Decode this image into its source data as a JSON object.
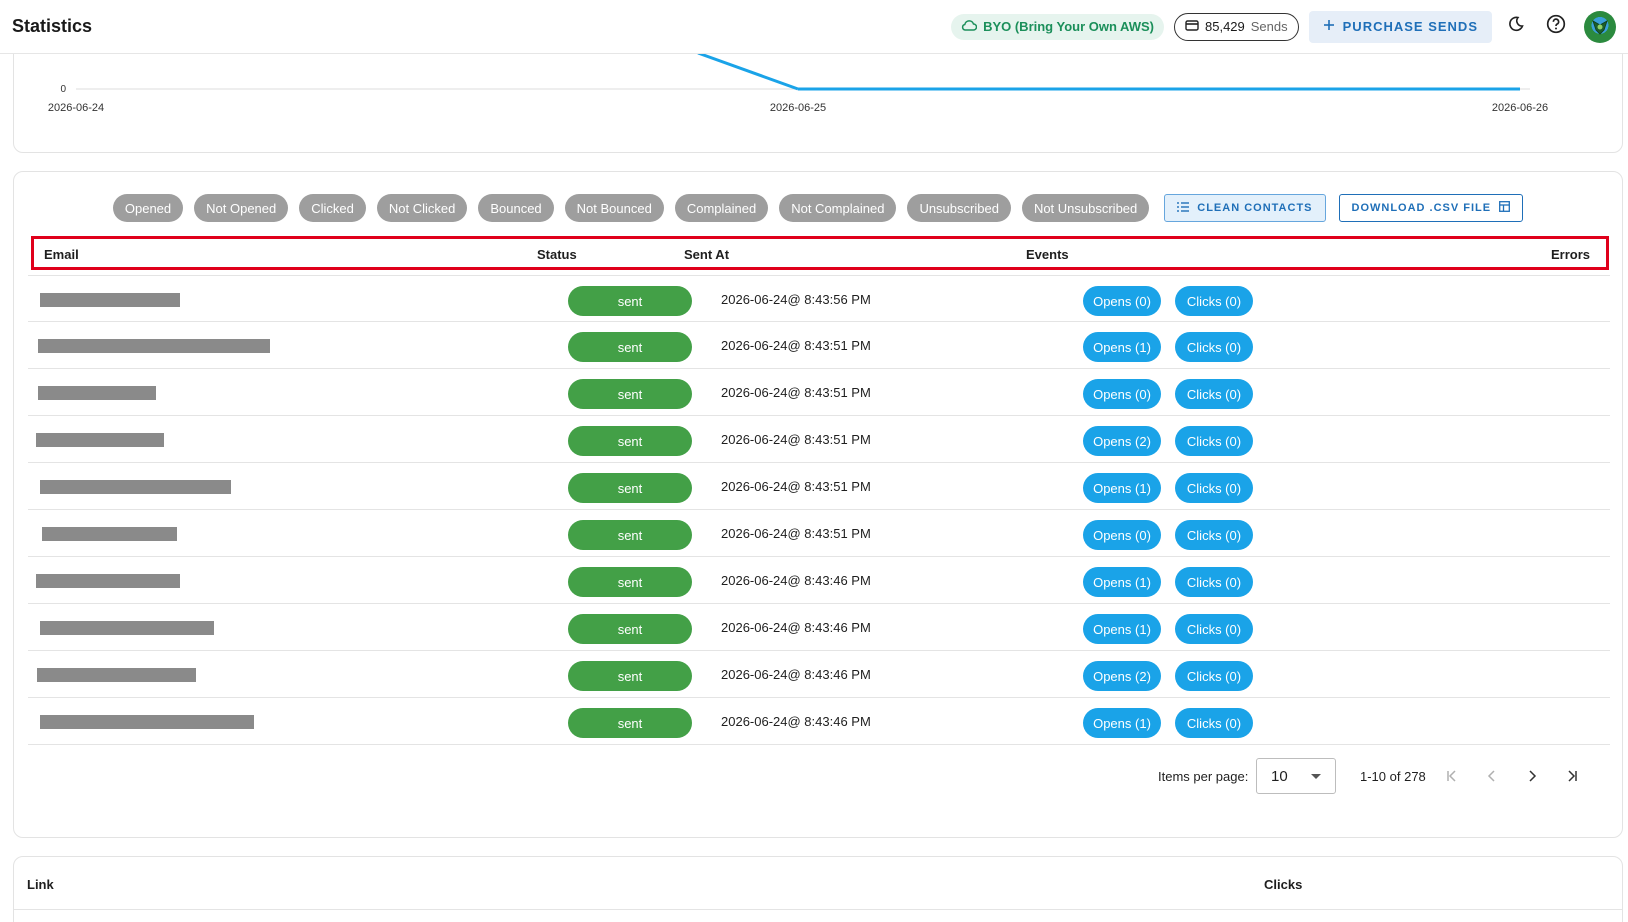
{
  "header": {
    "title": "Statistics",
    "byo_label": "BYO (Bring Your Own AWS)",
    "sends_count": "85,429",
    "sends_unit": "Sends",
    "purchase_label": "PURCHASE SENDS"
  },
  "icons": {
    "byo": "cloud-icon",
    "sends": "credit-card-icon",
    "purchase": "plus-icon",
    "theme": "moon-icon",
    "help": "help-circle-icon",
    "clean": "list-icon",
    "download": "table-icon"
  },
  "colors": {
    "status_sent": "#43a047",
    "event_pill": "#1aa3e8",
    "filter_chip": "#9e9e9e",
    "highlight_box": "#e0001b",
    "accent": "#1f6fb8",
    "chart_line": "#1aa3e8"
  },
  "chart_data": {
    "type": "line",
    "x": [
      "2026-06-24",
      "2026-06-25",
      "2026-06-26"
    ],
    "y_tick_labels": [
      "0"
    ],
    "series": [
      {
        "values": [
          null,
          0,
          0
        ]
      }
    ],
    "ylim": [
      0,
      null
    ]
  },
  "filters": [
    "Opened",
    "Not Opened",
    "Clicked",
    "Not Clicked",
    "Bounced",
    "Not Bounced",
    "Complained",
    "Not Complained",
    "Unsubscribed",
    "Not Unsubscribed"
  ],
  "actions": {
    "clean_label": "CLEAN CONTACTS",
    "download_label": "DOWNLOAD .CSV FILE"
  },
  "table": {
    "columns": {
      "email": "Email",
      "status": "Status",
      "sent_at": "Sent At",
      "events": "Events",
      "errors": "Errors"
    },
    "rows": [
      {
        "status": "sent",
        "sent_at": "2026-06-24@ 8:43:56 PM",
        "opens": "Opens (0)",
        "clicks": "Clicks (0)"
      },
      {
        "status": "sent",
        "sent_at": "2026-06-24@ 8:43:51 PM",
        "opens": "Opens (1)",
        "clicks": "Clicks (0)"
      },
      {
        "status": "sent",
        "sent_at": "2026-06-24@ 8:43:51 PM",
        "opens": "Opens (0)",
        "clicks": "Clicks (0)"
      },
      {
        "status": "sent",
        "sent_at": "2026-06-24@ 8:43:51 PM",
        "opens": "Opens (2)",
        "clicks": "Clicks (0)"
      },
      {
        "status": "sent",
        "sent_at": "2026-06-24@ 8:43:51 PM",
        "opens": "Opens (1)",
        "clicks": "Clicks (0)"
      },
      {
        "status": "sent",
        "sent_at": "2026-06-24@ 8:43:51 PM",
        "opens": "Opens (0)",
        "clicks": "Clicks (0)"
      },
      {
        "status": "sent",
        "sent_at": "2026-06-24@ 8:43:46 PM",
        "opens": "Opens (1)",
        "clicks": "Clicks (0)"
      },
      {
        "status": "sent",
        "sent_at": "2026-06-24@ 8:43:46 PM",
        "opens": "Opens (1)",
        "clicks": "Clicks (0)"
      },
      {
        "status": "sent",
        "sent_at": "2026-06-24@ 8:43:46 PM",
        "opens": "Opens (2)",
        "clicks": "Clicks (0)"
      },
      {
        "status": "sent",
        "sent_at": "2026-06-24@ 8:43:46 PM",
        "opens": "Opens (1)",
        "clicks": "Clicks (0)"
      }
    ]
  },
  "pagination": {
    "items_per_page_label": "Items per page:",
    "items_per_page": "10",
    "range": "1-10 of 278"
  },
  "links_table": {
    "columns": {
      "link": "Link",
      "clicks": "Clicks"
    }
  }
}
